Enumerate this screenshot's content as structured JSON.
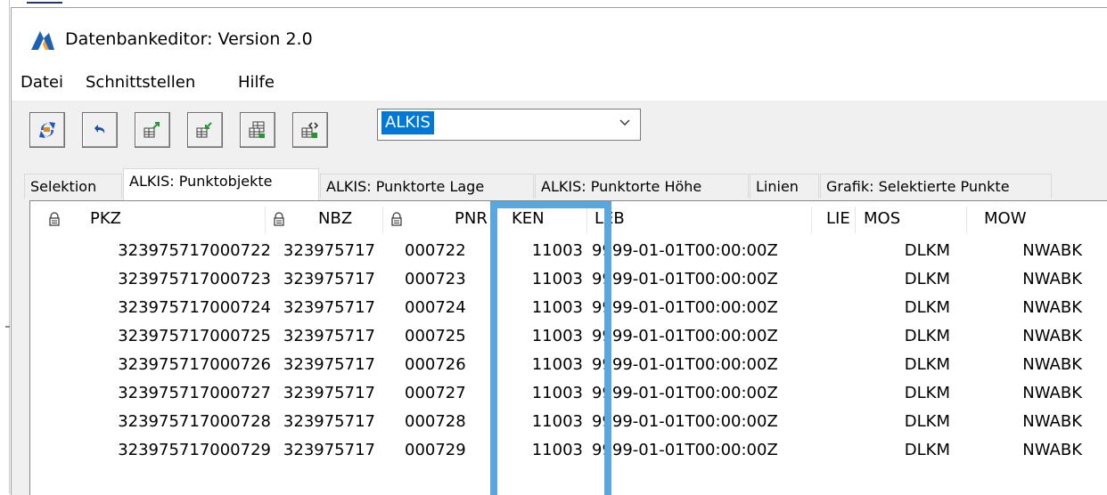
{
  "window": {
    "title": "Datenbankeditor: Version 2.0"
  },
  "menu": {
    "items": [
      "Datei",
      "Schnittstellen",
      "Hilfe"
    ]
  },
  "toolbar": {
    "buttons": [
      "refresh-icon",
      "undo-icon",
      "export-icon",
      "import-icon",
      "table-icon",
      "interface-icon"
    ],
    "combo_value": "ALKIS"
  },
  "tabs": [
    {
      "label": "Selektion",
      "active": false
    },
    {
      "label": "ALKIS: Punktobjekte",
      "active": true
    },
    {
      "label": "ALKIS: Punktorte Lage",
      "active": false
    },
    {
      "label": "ALKIS: Punktorte Höhe",
      "active": false
    },
    {
      "label": "Linien",
      "active": false
    },
    {
      "label": "Grafik: Selektierte Punkte",
      "active": false
    }
  ],
  "grid": {
    "columns": [
      "PKZ",
      "NBZ",
      "PNR",
      "KEN",
      "LEB",
      "LIE",
      "MOS",
      "MOW"
    ],
    "locked_columns": [
      "PKZ",
      "NBZ",
      "PNR"
    ],
    "rows": [
      {
        "PKZ": "323975717000722",
        "NBZ": "323975717",
        "PNR": "000722",
        "KEN": "11003",
        "LEB": "9999-01-01T00:00:00Z",
        "LIE": "",
        "MOS": "DLKM",
        "MOW": "NWABK"
      },
      {
        "PKZ": "323975717000723",
        "NBZ": "323975717",
        "PNR": "000723",
        "KEN": "11003",
        "LEB": "9999-01-01T00:00:00Z",
        "LIE": "",
        "MOS": "DLKM",
        "MOW": "NWABK"
      },
      {
        "PKZ": "323975717000724",
        "NBZ": "323975717",
        "PNR": "000724",
        "KEN": "11003",
        "LEB": "9999-01-01T00:00:00Z",
        "LIE": "",
        "MOS": "DLKM",
        "MOW": "NWABK"
      },
      {
        "PKZ": "323975717000725",
        "NBZ": "323975717",
        "PNR": "000725",
        "KEN": "11003",
        "LEB": "9999-01-01T00:00:00Z",
        "LIE": "",
        "MOS": "DLKM",
        "MOW": "NWABK"
      },
      {
        "PKZ": "323975717000726",
        "NBZ": "323975717",
        "PNR": "000726",
        "KEN": "11003",
        "LEB": "9999-01-01T00:00:00Z",
        "LIE": "",
        "MOS": "DLKM",
        "MOW": "NWABK"
      },
      {
        "PKZ": "323975717000727",
        "NBZ": "323975717",
        "PNR": "000727",
        "KEN": "11003",
        "LEB": "9999-01-01T00:00:00Z",
        "LIE": "",
        "MOS": "DLKM",
        "MOW": "NWABK"
      },
      {
        "PKZ": "323975717000728",
        "NBZ": "323975717",
        "PNR": "000728",
        "KEN": "11003",
        "LEB": "9999-01-01T00:00:00Z",
        "LIE": "",
        "MOS": "DLKM",
        "MOW": "NWABK"
      },
      {
        "PKZ": "323975717000729",
        "NBZ": "323975717",
        "PNR": "000729",
        "KEN": "11003",
        "LEB": "9999-01-01T00:00:00Z",
        "LIE": "",
        "MOS": "DLKM",
        "MOW": "NWABK"
      }
    ]
  },
  "highlight": {
    "column": "KEN",
    "color": "#5aa7de"
  },
  "colors": {
    "selection": "#0078d7",
    "app_icon": "#1c5fb4"
  }
}
